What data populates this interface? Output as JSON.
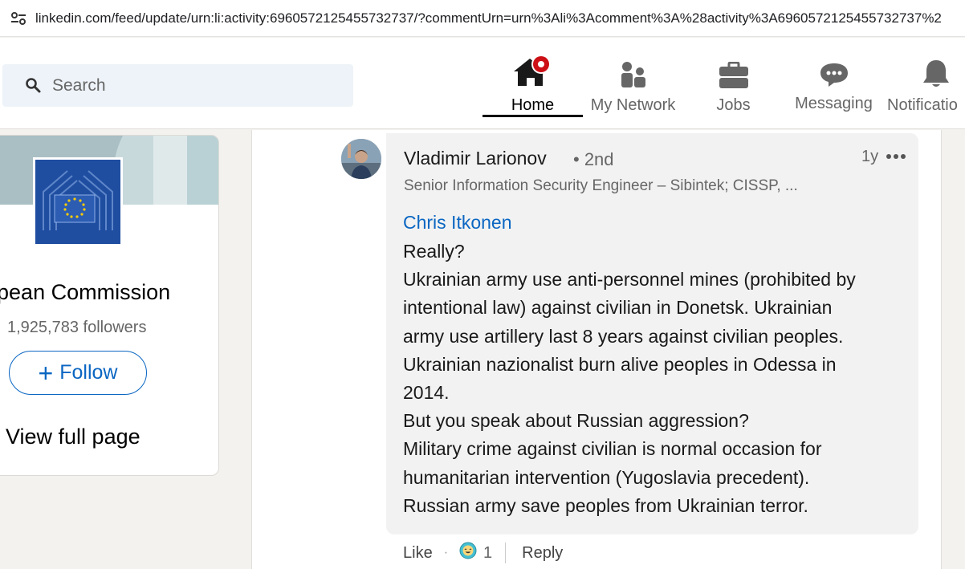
{
  "browser": {
    "url": "linkedin.com/feed/update/urn:li:activity:6960572125455732737/?commentUrn=urn%3Ali%3Acomment%3A%28activity%3A6960572125455732737%2"
  },
  "header": {
    "search_placeholder": "Search",
    "nav": {
      "home": "Home",
      "network": "My Network",
      "jobs": "Jobs",
      "messaging": "Messaging",
      "notifications": "Notificatio"
    },
    "notification_dot_color": "#cc1016"
  },
  "company": {
    "name": "opean Commission",
    "followers": "1,925,783 followers",
    "follow_label": "Follow",
    "view_full_label": "View full page"
  },
  "comment": {
    "author": "Vladimir Larionov",
    "degree": "• 2nd",
    "headline": "Senior Information Security Engineer – Sibintek; CISSP, ...",
    "time": "1y",
    "mention": "Chris Itkonen",
    "lines": [
      "Really?",
      "Ukrainian army use anti-personnel mines (prohibited by",
      "intentional law) against civilian in Donetsk. Ukrainian",
      "army use artillery last 8 years against civilian peoples.",
      "Ukrainian nazionalist burn alive peoples in Odessa in",
      "2014.",
      "But you speak about Russian aggression?",
      "Military crime against civilian is normal occasion for",
      "humanitarian intervention (Yugoslavia precedent).",
      "Russian army save peoples from Ukrainian terror."
    ],
    "actions": {
      "like": "Like",
      "dot": "·",
      "reaction_icon": "funny-reaction-icon",
      "reaction_count": "1",
      "reply": "Reply"
    }
  },
  "colors": {
    "accent": "#0a66c2",
    "background": "#f4f2ee"
  }
}
